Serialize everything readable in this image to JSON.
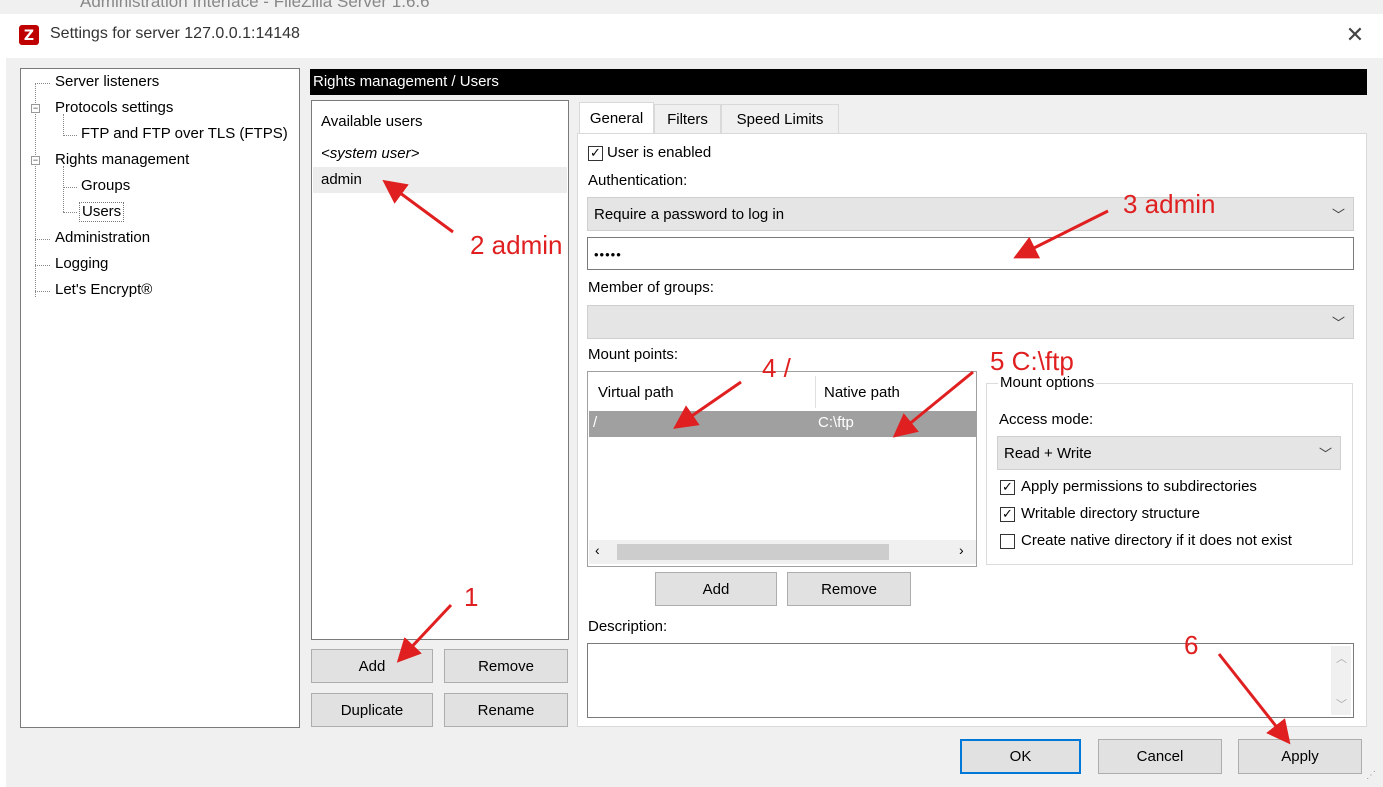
{
  "background_window": {
    "title": "Administration Interface - FileZilla Server 1.6.6"
  },
  "dialog": {
    "title": "Settings for server 127.0.0.1:14148"
  },
  "tree": {
    "items": [
      {
        "label": "Server listeners"
      },
      {
        "label": "Protocols settings"
      },
      {
        "label": "FTP and FTP over TLS (FTPS)"
      },
      {
        "label": "Rights management"
      },
      {
        "label": "Groups"
      },
      {
        "label": "Users"
      },
      {
        "label": "Administration"
      },
      {
        "label": "Logging"
      },
      {
        "label": "Let's Encrypt®"
      }
    ]
  },
  "header": {
    "title": "Rights management / Users"
  },
  "users": {
    "heading": "Available users",
    "items": [
      "<system user>",
      "admin"
    ],
    "buttons": {
      "add": "Add",
      "remove": "Remove",
      "duplicate": "Duplicate",
      "rename": "Rename"
    }
  },
  "tabs": [
    "General",
    "Filters",
    "Speed Limits"
  ],
  "general": {
    "user_enabled": {
      "label": "User is enabled",
      "checked": true
    },
    "authentication_label": "Authentication:",
    "authentication_value": "Require a password to log in",
    "password_value": "•••••",
    "groups_label": "Member of groups:",
    "groups_value": "",
    "mount_points_label": "Mount points:",
    "mount_columns": [
      "Virtual path",
      "Native path"
    ],
    "mount_rows": [
      {
        "virtual": "/",
        "native": "C:\\ftp"
      }
    ],
    "mount_buttons": {
      "add": "Add",
      "remove": "Remove"
    },
    "mount_options": {
      "legend": "Mount options",
      "access_mode_label": "Access mode:",
      "access_mode_value": "Read + Write",
      "checks": [
        {
          "label": "Apply permissions to subdirectories",
          "checked": true
        },
        {
          "label": "Writable directory structure",
          "checked": true
        },
        {
          "label": "Create native directory if it does not exist",
          "checked": false
        }
      ]
    },
    "description_label": "Description:"
  },
  "footer": {
    "ok": "OK",
    "cancel": "Cancel",
    "apply": "Apply"
  },
  "annotations": [
    "1",
    "2 admin",
    "3 admin",
    "4 /",
    "5 C:\\ftp",
    "6"
  ],
  "colors": {
    "annotation": "#e02020",
    "header_bg": "#000000",
    "selected_row": "#a0a0a0",
    "default_button_border": "#0078d7"
  }
}
